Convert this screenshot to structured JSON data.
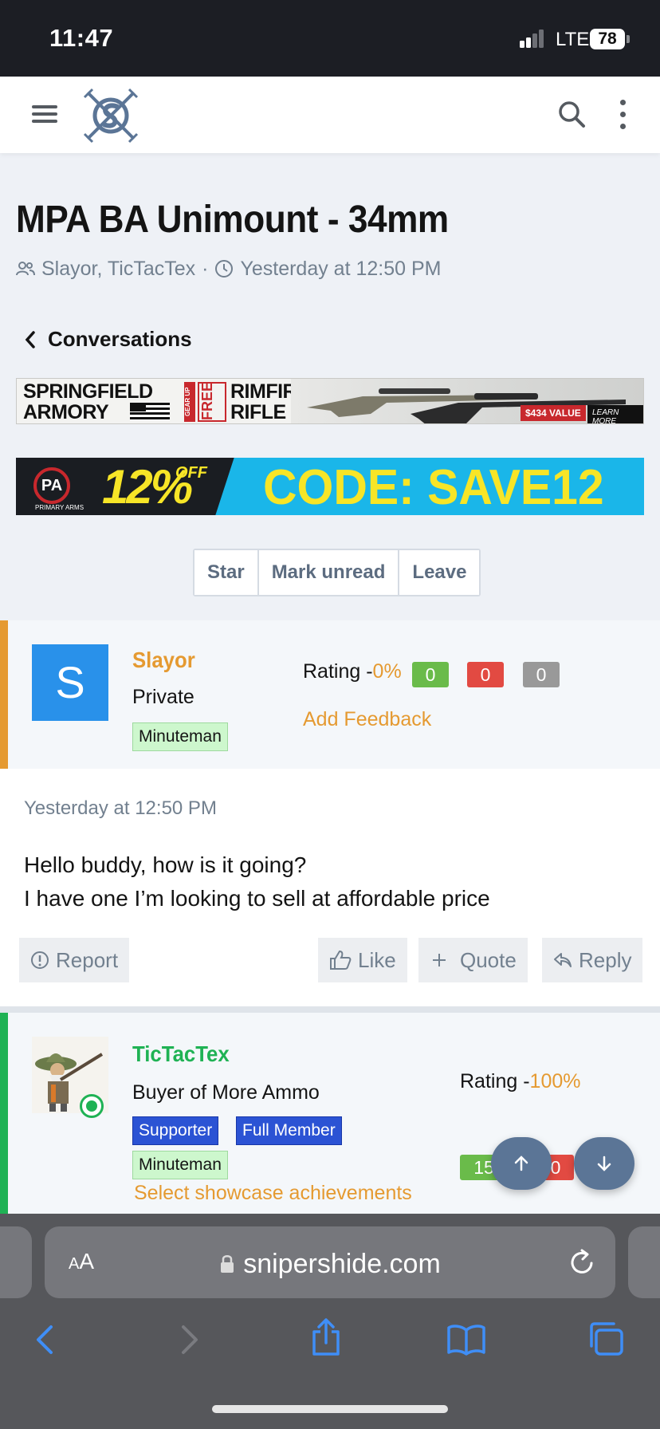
{
  "status_bar": {
    "time": "11:47",
    "network": "LTE",
    "battery": "78"
  },
  "thread": {
    "title": "MPA BA Unimount - 34mm",
    "participants": "Slayor, TicTacTex",
    "started": "Yesterday at 12:50 PM",
    "separator": "·"
  },
  "nav": {
    "back_label": "Conversations"
  },
  "ads": {
    "springfield": {
      "brand_line1": "SPRINGFIELD",
      "brand_line2": "ARMORY",
      "gear_up": "GEAR UP",
      "free": "FREE",
      "rimfire_line1": "RIMFIRE",
      "rimfire_line2": "RIFLE",
      "value": "$434 VALUE",
      "learn_more": "LEARN MORE"
    },
    "primary_arms": {
      "logo": "PA",
      "logo_label": "PRIMARY ARMS",
      "percent": "12%",
      "off": "OFF",
      "code": "CODE: SAVE12"
    }
  },
  "actions": {
    "star": "Star",
    "mark_unread": "Mark unread",
    "leave": "Leave"
  },
  "messages": [
    {
      "avatar_letter": "S",
      "username": "Slayor",
      "user_title": "Private",
      "badges": [
        "Minuteman"
      ],
      "rating_label": "Rating -",
      "rating_pct": "0%",
      "counts": [
        "0",
        "0",
        "0"
      ],
      "add_feedback": "Add Feedback",
      "time": "Yesterday at 12:50 PM",
      "lines": [
        "Hello buddy, how is it going?",
        "I have one I’m looking to sell at affordable price"
      ],
      "buttons": {
        "report": "Report",
        "like": "Like",
        "quote": "Quote",
        "reply": "Reply"
      }
    },
    {
      "username": "TicTacTex",
      "user_title": "Buyer of More Ammo",
      "badges": [
        "Supporter",
        "Full Member",
        "Minuteman"
      ],
      "rating_label": "Rating -",
      "rating_pct": "100%",
      "counts": [
        "15",
        "0"
      ],
      "showcase": "Select showcase achievements"
    }
  ],
  "browser": {
    "aa_big": "A",
    "aa_small": "A",
    "url": "snipershide.com"
  },
  "colors": {
    "accent_orange": "#e59a31",
    "accent_green": "#1fb254",
    "avatar_blue": "#2991ea",
    "fab": "#5b7596"
  },
  "icons": [
    "hamburger-icon",
    "site-logo-icon",
    "search-icon",
    "kebab-icon",
    "users-icon",
    "clock-icon",
    "chevron-left-icon",
    "alert-circle-icon",
    "thumbs-up-icon",
    "plus-icon",
    "reply-icon",
    "arrow-up-icon",
    "arrow-down-icon",
    "lock-icon",
    "reload-icon",
    "back-icon",
    "forward-icon",
    "share-icon",
    "bookmarks-icon",
    "tabs-icon"
  ]
}
